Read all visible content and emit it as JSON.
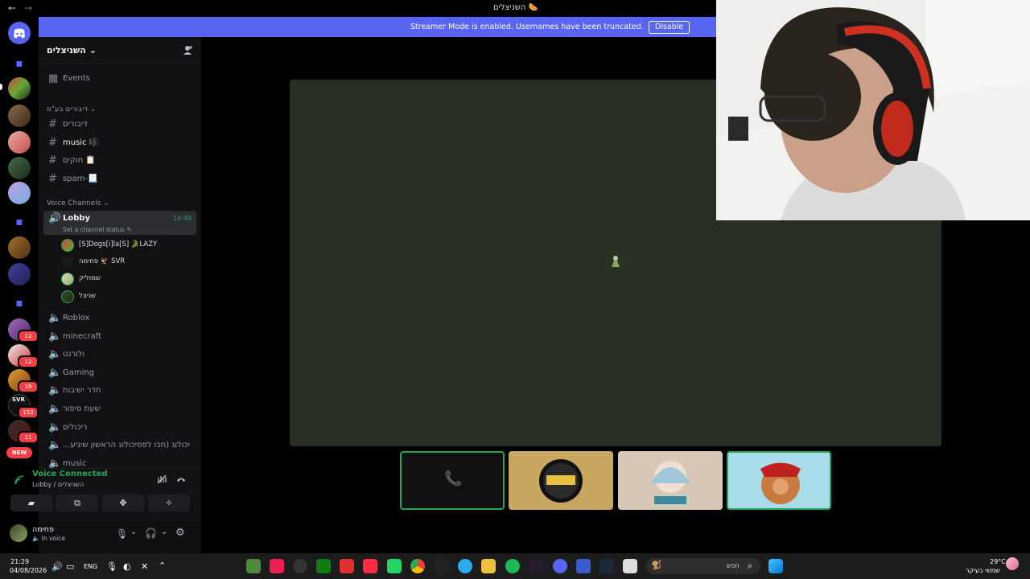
{
  "window": {
    "title": "השניצלים 🌭"
  },
  "banner": {
    "text": "Streamer Mode is enabled. Usernames have been truncated.",
    "disable_label": "Disable"
  },
  "server": {
    "name": "השניצלים"
  },
  "sidebar": {
    "events_label": "Events",
    "text_category": "דיבורים בע\"מ",
    "text_channels": [
      "דיבורים",
      "music 🎼",
      "חוקים 📋",
      "spam-📃"
    ],
    "voice_category": "Voice Channels",
    "lobby": {
      "name": "Lobby",
      "time": "14:49",
      "status_prompt": "Set a channel status"
    },
    "members": [
      "[S]Dogs[i]la[S] 🐊LAZY",
      "פחימה 🦅 SVR",
      "שמוליק",
      "שניצל"
    ],
    "voice_channels": [
      "Roblox",
      "minecraft",
      "ולורנט",
      "Gaming",
      "חדר ישיבות",
      "שעת סיפור",
      "ריכולים",
      "...יכולוג (חכו לפסיכולוג הראשון שיגיע",
      "music"
    ]
  },
  "voice": {
    "connected_label": "Voice Connected",
    "location": "Lobby / השניצלים"
  },
  "user": {
    "name": "פחימה",
    "status": "In voice"
  },
  "rail": {
    "badges": [
      "12",
      "12",
      "39",
      "153",
      "11"
    ],
    "new_label": "NEW",
    "svr_label": "SVR"
  },
  "taskbar": {
    "time": "21:29",
    "date": "04/08/2026",
    "lang": "ENG",
    "search_placeholder": "חפש",
    "weather_temp": "29°C",
    "weather_desc": "שמשי בעיקר"
  },
  "colors": {
    "accent": "#5865f2",
    "speaking": "#23a55a",
    "stage_bg": "#272f22",
    "badge": "#f23f43"
  }
}
